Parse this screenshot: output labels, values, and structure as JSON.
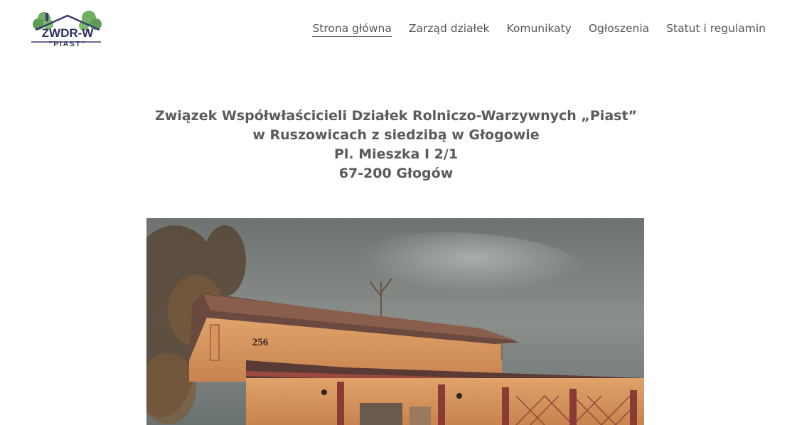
{
  "logo": {
    "main_text": "ZWDR-W",
    "sub_text": "\"PIAST\""
  },
  "nav": {
    "items": [
      {
        "label": "Strona główna",
        "active": true
      },
      {
        "label": "Zarząd działek",
        "active": false
      },
      {
        "label": "Komunikaty",
        "active": false
      },
      {
        "label": "Ogłoszenia",
        "active": false
      },
      {
        "label": "Statut i regulamin",
        "active": false
      }
    ]
  },
  "heading": {
    "line1": "Związek Współwłaścicieli Działek Rolniczo-Warzywnych „Piast”",
    "line2": "w Ruszowicach z siedzibą w Głogowie",
    "line3": "Pl. Mieszka I 2/1",
    "line4": "67-200 Głogów"
  },
  "photo": {
    "house_number": "256"
  },
  "colors": {
    "text": "#555555",
    "heading": "#5b5b5b",
    "background": "#ffffff"
  }
}
